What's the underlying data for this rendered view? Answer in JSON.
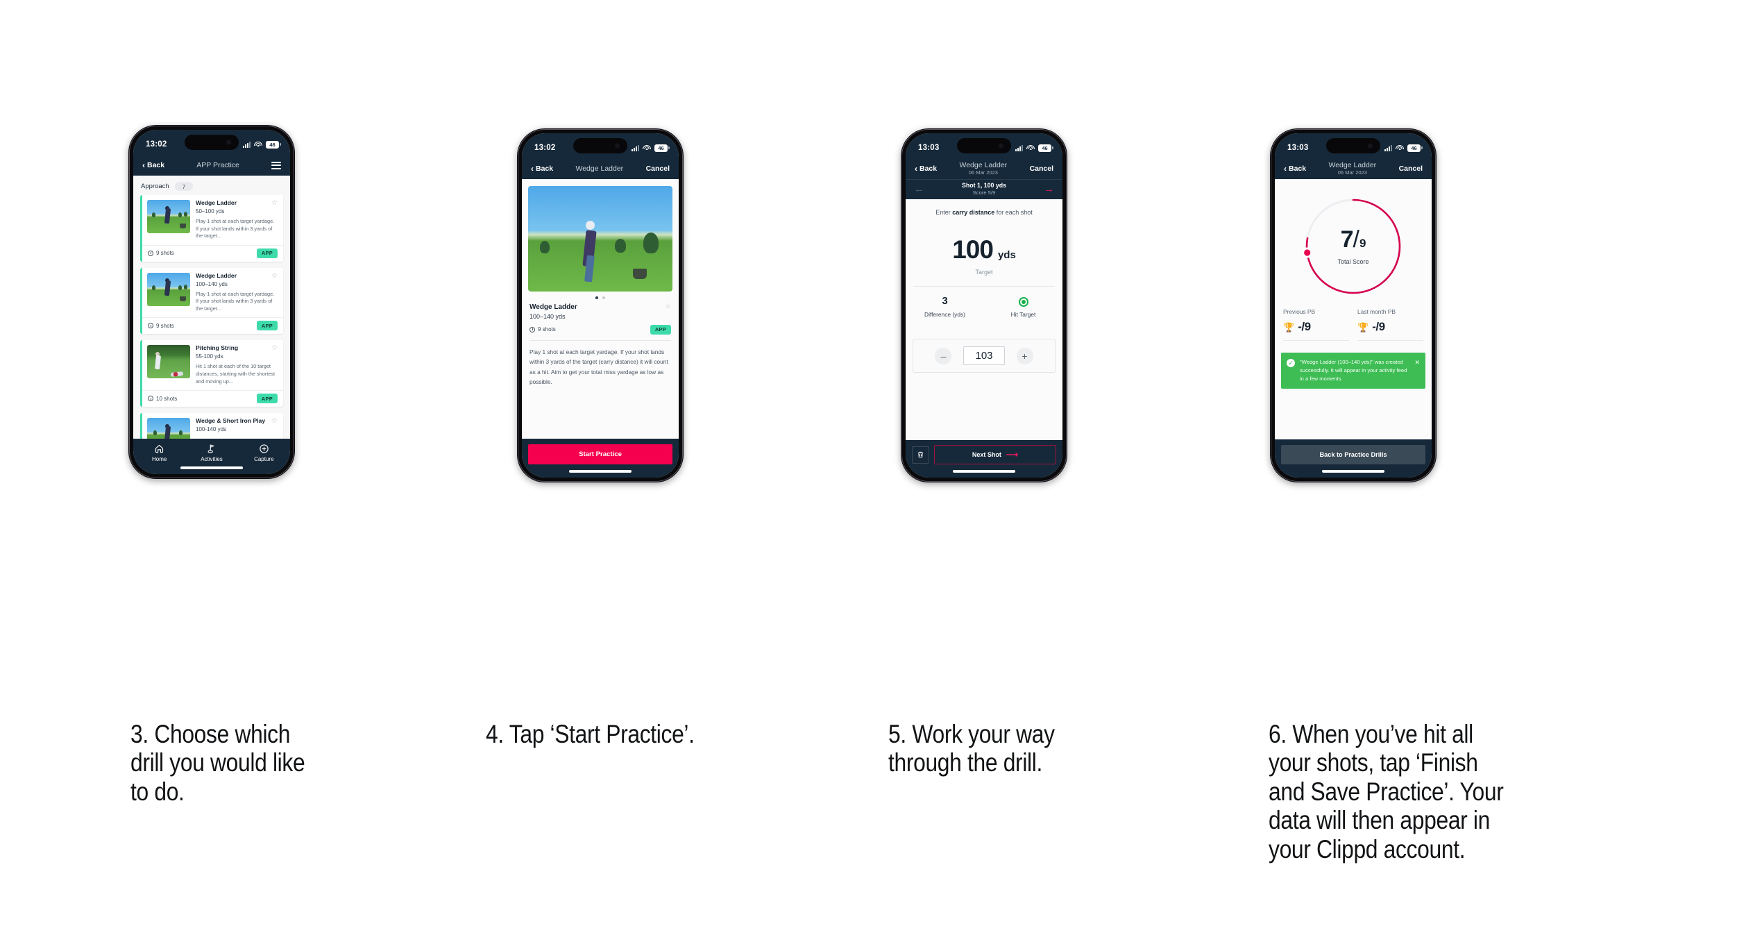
{
  "phones": [
    {
      "status": {
        "time": "13:02",
        "battery": "46"
      },
      "nav": {
        "back": "Back",
        "title": "APP Practice",
        "menu_icon": "hamburger-icon"
      },
      "category": {
        "label": "Approach",
        "count": "7"
      },
      "drills": [
        {
          "title": "Wedge Ladder",
          "range": "50–100 yds",
          "description": "Play 1 shot at each target yardage. If your shot lands within 3 yards of the target...",
          "shots": "9 shots",
          "badge": "APP"
        },
        {
          "title": "Wedge Ladder",
          "range": "100–140 yds",
          "description": "Play 1 shot at each target yardage. If your shot lands within 3 yards of the target...",
          "shots": "9 shots",
          "badge": "APP"
        },
        {
          "title": "Pitching String",
          "range": "55-100 yds",
          "description": "Hit 1 shot at each of the 10 target distances, starting with the shortest and moving up...",
          "shots": "10 shots",
          "badge": "APP"
        },
        {
          "title": "Wedge & Short Iron Play",
          "range": "100-140 yds",
          "description": "",
          "shots": "",
          "badge": ""
        }
      ],
      "tabs": [
        {
          "label": "Home",
          "icon": "home-icon"
        },
        {
          "label": "Activities",
          "icon": "golf-flag-icon"
        },
        {
          "label": "Capture",
          "icon": "plus-circle-icon"
        }
      ]
    },
    {
      "status": {
        "time": "13:02",
        "battery": "46"
      },
      "nav": {
        "back": "Back",
        "title": "Wedge Ladder",
        "cancel": "Cancel"
      },
      "detail": {
        "title": "Wedge Ladder",
        "range": "100–140 yds",
        "shots": "9 shots",
        "badge": "APP",
        "description": "Play 1 shot at each target yardage. If your shot lands within 3 yards of the target (carry distance) it will count as a hit. Aim to get your total miss yardage as low as possible."
      },
      "cta": "Start Practice"
    },
    {
      "status": {
        "time": "13:03",
        "battery": "46"
      },
      "nav": {
        "back": "Back",
        "title": "Wedge Ladder",
        "subtitle": "06 Mar 2023",
        "cancel": "Cancel"
      },
      "shotnav": {
        "title": "Shot 1, 100 yds",
        "score": "Score 5/9"
      },
      "lead_prefix": "Enter ",
      "lead_bold": "carry distance",
      "lead_suffix": " for each shot",
      "target_value": "100",
      "target_unit": "yds",
      "target_label": "Target",
      "stats": [
        {
          "value": "3",
          "label": "Difference (yds)"
        },
        {
          "value": "",
          "label": "Hit Target",
          "icon": "target-hit-icon"
        }
      ],
      "stepper": {
        "minus": "–",
        "value": "103",
        "plus": "+"
      },
      "footer": {
        "delete_icon": "trash-icon",
        "next": "Next Shot"
      }
    },
    {
      "status": {
        "time": "13:03",
        "battery": "46"
      },
      "nav": {
        "back": "Back",
        "title": "Wedge Ladder",
        "subtitle": "06 Mar 2023",
        "cancel": "Cancel"
      },
      "score": {
        "made": "7",
        "slash": "/",
        "total": "9",
        "label": "Total Score"
      },
      "pbs": [
        {
          "label": "Previous PB",
          "value": "-/9",
          "icon": "trophy-icon"
        },
        {
          "label": "Last month PB",
          "value": "-/9",
          "icon": "trophy-icon"
        }
      ],
      "toast": {
        "message": "\"Wedge Ladder (100–140 yds)\" was created successfully. It will appear in your activity feed in a few moments.",
        "check_icon": "check-circle-icon",
        "close_icon": "close-icon"
      },
      "footer_button": "Back to Practice Drills"
    }
  ],
  "captions": [
    "3. Choose which drill you would like to do.",
    "4. Tap ‘Start Practice’.",
    "5. Work your way through the drill.",
    "6. When you’ve hit all your shots, tap ‘Finish and Save Practice’. Your data will then appear in your Clippd account."
  ],
  "colors": {
    "navy": "#16293a",
    "pink": "#f4004f",
    "teal": "#3ddbaa",
    "green": "#3fbd55",
    "crimson": "#d6004e"
  }
}
